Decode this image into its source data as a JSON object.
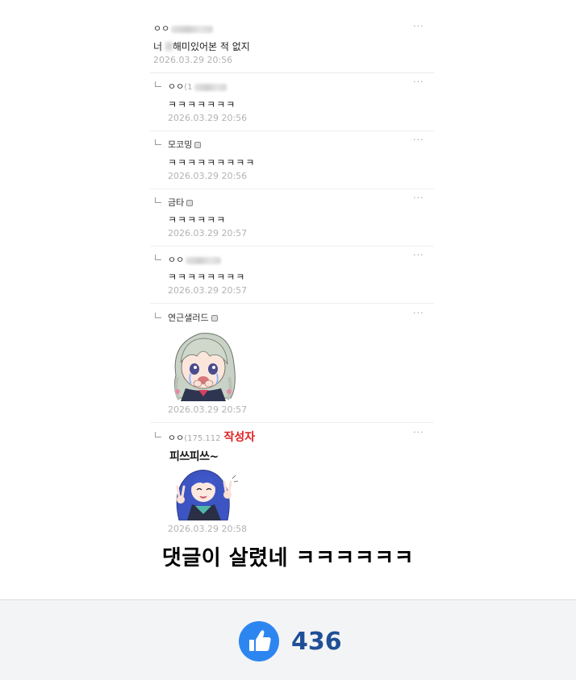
{
  "comments": [
    {
      "author": "ㅇㅇ",
      "ip": "",
      "text_before": "너",
      "text_after": "해미있어본 적 없지",
      "date": "2026.03.29 20:56",
      "menu": "···"
    },
    {
      "author": "ㅇㅇ",
      "ip": "(1",
      "text": "ㅋㅋㅋㅋㅋㅋㅋ",
      "date": "2026.03.29 20:56",
      "menu": "···"
    },
    {
      "author": "모코밍",
      "text": "ㅋㅋㅋㅋㅋㅋㅋㅋㅋ",
      "date": "2026.03.29 20:56",
      "menu": "···"
    },
    {
      "author": "금타",
      "text": "ㅋㅋㅋㅋㅋㅋ",
      "date": "2026.03.29 20:57",
      "menu": "···"
    },
    {
      "author": "ㅇㅇ",
      "ip": "",
      "text": "ㅋㅋㅋㅋㅋㅋㅋㅋ",
      "date": "2026.03.29 20:57",
      "menu": "···"
    },
    {
      "author": "연근샐러드",
      "date": "2026.03.29 20:57",
      "menu": "···"
    },
    {
      "author": "ㅇㅇ",
      "ip": "(175.112",
      "writer_tag": "작성자",
      "sticker_text": "피쓰피쓰~",
      "date": "2026.03.29 20:58",
      "menu": "···"
    }
  ],
  "caption": "댓글이 살렸네 ㅋㅋㅋㅋㅋㅋ",
  "like": {
    "count": "436",
    "icon": "thumbs-up-icon",
    "color": "#2d86f0"
  }
}
